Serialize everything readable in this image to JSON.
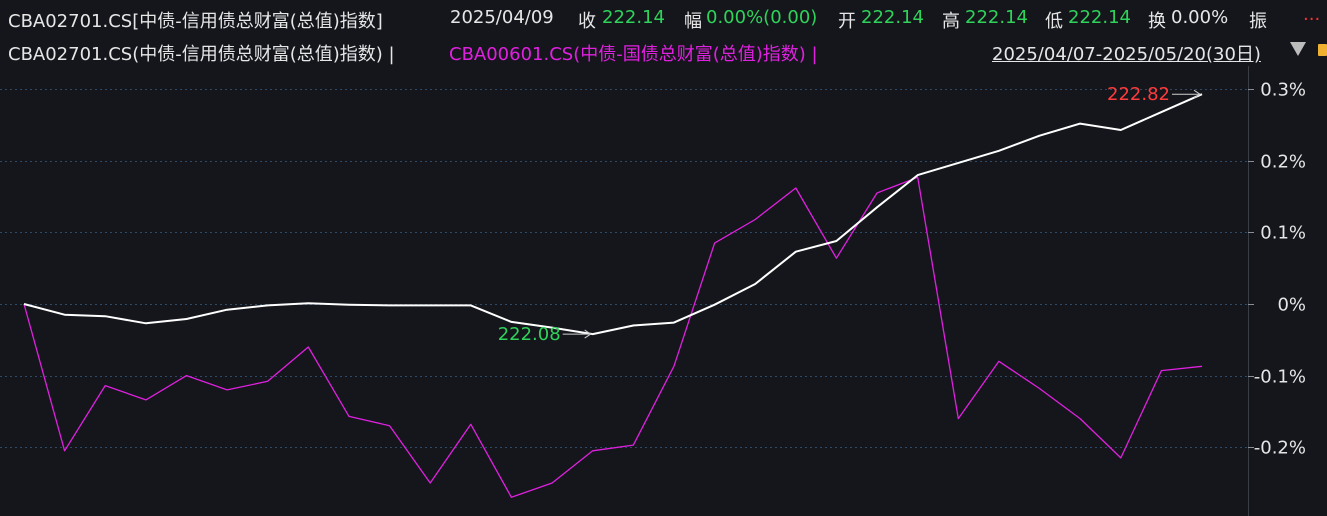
{
  "header": {
    "title": "CBA02701.CS[中债-信用债总财富(总值)指数]",
    "date": "2025/04/09",
    "close_label": "收",
    "close_value": "222.14",
    "change_label": "幅",
    "change_value": "0.00%(0.00)",
    "open_label": "开",
    "open_value": "222.14",
    "high_label": "高",
    "high_value": "222.14",
    "low_label": "低",
    "low_value": "222.14",
    "turnover_label": "换",
    "turnover_value": "0.00%",
    "amplitude_label": "振",
    "more_glyph": "..."
  },
  "legend": {
    "series1": "CBA02701.CS(中债-信用债总财富(总值)指数) |",
    "series2": "CBA00601.CS(中债-国债总财富(总值)指数) |",
    "date_range": "2025/04/07-2025/05/20(30日)"
  },
  "colors": {
    "background": "#14161c",
    "series1": "#ffffff",
    "series2": "#e020e0",
    "up": "#ff3b3b",
    "down": "#2fd35a",
    "grid": "#2e4a66",
    "axis_text": "#e6e6e6"
  },
  "chart_data": {
    "type": "line",
    "y_unit": "%",
    "ylim": [
      -0.25,
      0.3
    ],
    "y_ticks": [
      0.3,
      0.2,
      0.1,
      0,
      -0.1,
      -0.2
    ],
    "y_tick_labels": [
      "0.3%",
      "0.2%",
      "0.1%",
      "0%",
      "-0.1%",
      "-0.2%"
    ],
    "grid": true,
    "series": [
      {
        "name": "CBA02701.CS(中债-信用债总财富(总值)指数)",
        "values": [
          0.0,
          -0.015,
          -0.017,
          -0.027,
          -0.021,
          -0.008,
          -0.002,
          0.001,
          -0.001,
          -0.002,
          -0.002,
          -0.002,
          -0.025,
          -0.033,
          -0.042,
          -0.03,
          -0.026,
          -0.001,
          0.028,
          0.073,
          0.088,
          0.135,
          0.18,
          0.197,
          0.214,
          0.235,
          0.252,
          0.243,
          0.268,
          0.293
        ]
      },
      {
        "name": "CBA00601.CS(中债-国债总财富(总值)指数)",
        "values": [
          0.0,
          -0.205,
          -0.114,
          -0.134,
          -0.1,
          -0.12,
          -0.108,
          -0.06,
          -0.157,
          -0.17,
          -0.25,
          -0.168,
          -0.27,
          -0.25,
          -0.205,
          -0.197,
          -0.087,
          0.085,
          0.118,
          0.162,
          0.064,
          0.155,
          0.177,
          -0.16,
          -0.08,
          -0.118,
          -0.16,
          -0.215,
          -0.093,
          -0.087
        ]
      }
    ],
    "annotations": [
      {
        "text": "222.08",
        "series": 0,
        "index": 14,
        "kind": "low"
      },
      {
        "text": "222.82",
        "series": 0,
        "index": 29,
        "kind": "high"
      }
    ]
  }
}
